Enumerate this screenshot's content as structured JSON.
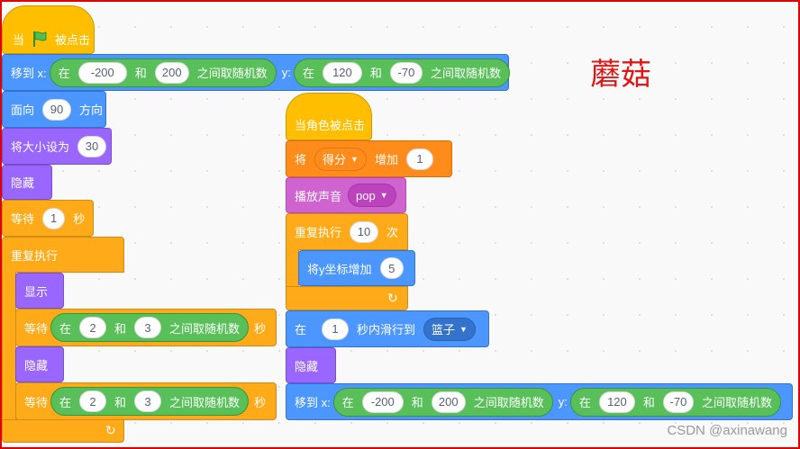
{
  "scripts": {
    "left": {
      "hat": {
        "prefix": "当",
        "suffix": "被点击"
      },
      "goto": {
        "label": "移到 x:",
        "x_in": "在",
        "x_min": "-200",
        "x_and": "和",
        "x_max": "200",
        "x_tail": "之间取随机数",
        "y_label": "y:",
        "y_in": "在",
        "y_min": "120",
        "y_and": "和",
        "y_max": "-70",
        "y_tail": "之间取随机数"
      },
      "face": {
        "label": "面向",
        "value": "90",
        "tail": "方向"
      },
      "size": {
        "label": "将大小设为",
        "value": "30"
      },
      "hide": {
        "label": "隐藏"
      },
      "wait1": {
        "label": "等待",
        "value": "1",
        "tail": "秒"
      },
      "forever": {
        "label": "重复执行"
      },
      "show": {
        "label": "显示"
      },
      "wait_rand1": {
        "label": "等待",
        "in": "在",
        "min": "2",
        "and": "和",
        "max": "3",
        "tail": "之间取随机数",
        "unit": "秒"
      },
      "hide2": {
        "label": "隐藏"
      },
      "wait_rand2": {
        "label": "等待",
        "in": "在",
        "min": "2",
        "and": "和",
        "max": "3",
        "tail": "之间取随机数",
        "unit": "秒"
      }
    },
    "right": {
      "hat": {
        "label": "当角色被点击"
      },
      "change": {
        "label": "将",
        "var": "得分",
        "verb": "增加",
        "value": "1"
      },
      "sound": {
        "label": "播放声音",
        "sound": "pop"
      },
      "repeat": {
        "label": "重复执行",
        "value": "10",
        "tail": "次"
      },
      "change_y": {
        "label": "将y坐标增加",
        "value": "5"
      },
      "glide": {
        "label": "在",
        "value": "1",
        "mid": "秒内滑行到",
        "target": "篮子"
      },
      "hide": {
        "label": "隐藏"
      },
      "goto": {
        "label": "移到 x:",
        "x_in": "在",
        "x_min": "-200",
        "x_and": "和",
        "x_max": "200",
        "x_tail": "之间取随机数",
        "y_label": "y:",
        "y_in": "在",
        "y_min": "120",
        "y_and": "和",
        "y_max": "-70",
        "y_tail": "之间取随机数"
      }
    }
  },
  "watermark": "蘑菇",
  "credit": "CSDN @axinawang",
  "icons": {
    "flag": "green-flag-icon",
    "loop": "loop-arrow-icon",
    "dropdown": "dropdown-triangle-icon"
  },
  "colors": {
    "motion": "#4c97ff",
    "events": "#ffbf00",
    "control": "#ffab19",
    "looks": "#9966ff",
    "sound": "#cf63cf",
    "variables": "#ff8c1a",
    "operators": "#59c059",
    "frame": "#e00000"
  }
}
